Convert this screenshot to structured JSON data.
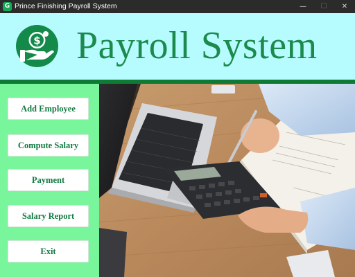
{
  "window": {
    "title": "Prince Finishing Payroll System",
    "icon_letter": "G",
    "controls": {
      "minimize": "—",
      "maximize": "☐",
      "close": "✕"
    }
  },
  "header": {
    "title": "Payroll System",
    "background": "#b6fbfe",
    "accent": "#1c8a4c",
    "logo_icon": "money-hand-icon"
  },
  "sidebar": {
    "background": "#79f59c",
    "items": [
      {
        "label": "Add Employee"
      },
      {
        "label": "Compute Salary"
      },
      {
        "label": "Payment"
      },
      {
        "label": "Salary Report"
      },
      {
        "label": "Exit"
      }
    ]
  },
  "main": {
    "image": "laptop-calculator-photo"
  }
}
